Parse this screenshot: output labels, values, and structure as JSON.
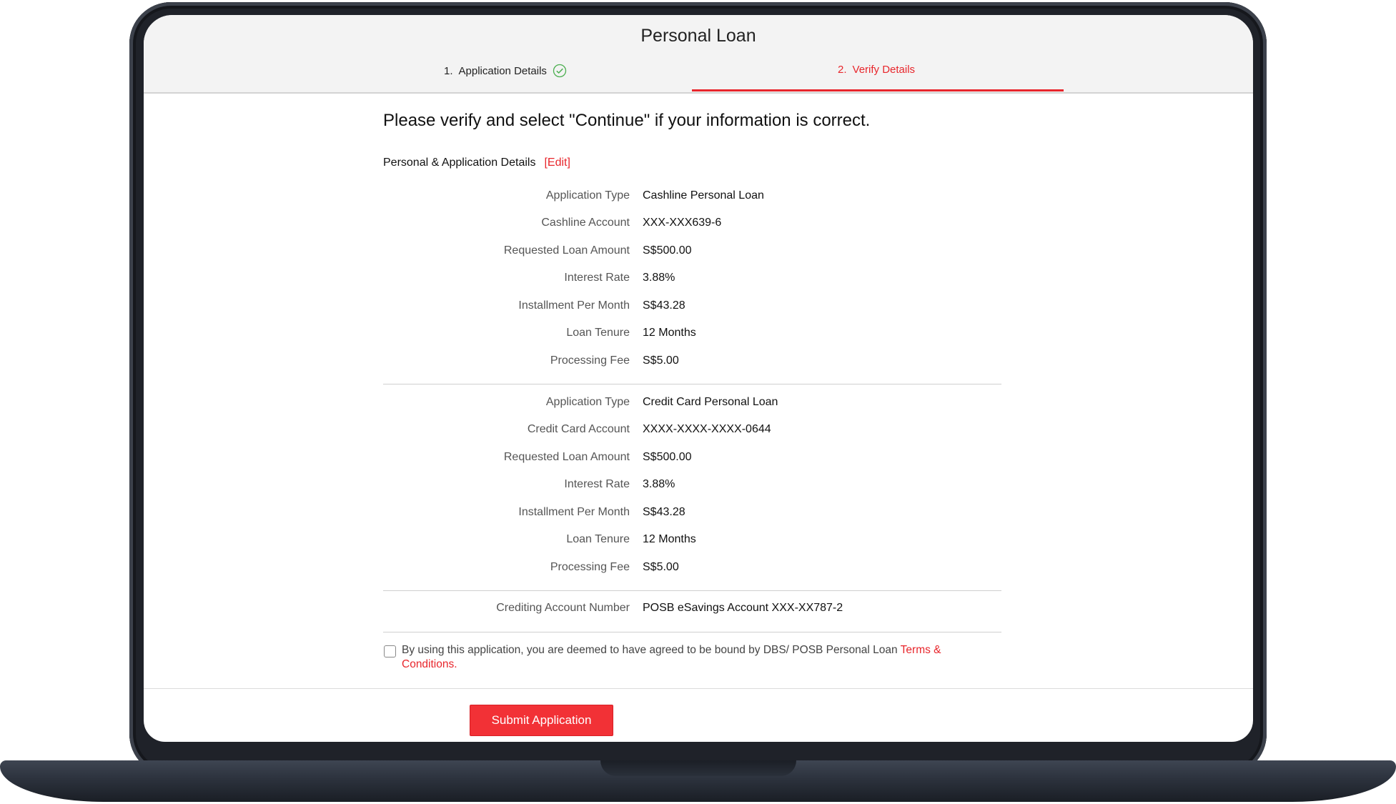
{
  "app": {
    "title": "Personal Loan"
  },
  "steps": [
    {
      "number": "1.",
      "label": "Application Details",
      "status": "completed",
      "icon": "check-circle-icon"
    },
    {
      "number": "2.",
      "label": "Verify Details",
      "status": "active"
    }
  ],
  "verify": {
    "heading": "Please verify and select \"Continue\" if your information is correct.",
    "section_title": "Personal & Application Details",
    "edit_label": "[Edit]"
  },
  "cashline_loan": [
    {
      "label": "Application Type",
      "value": "Cashline Personal Loan"
    },
    {
      "label": "Cashline Account",
      "value": "XXX-XXX639-6"
    },
    {
      "label": "Requested Loan Amount",
      "value": "S$500.00"
    },
    {
      "label": "Interest Rate",
      "value": "3.88%"
    },
    {
      "label": "Installment Per Month",
      "value": "S$43.28"
    },
    {
      "label": "Loan Tenure",
      "value": "12 Months"
    },
    {
      "label": "Processing Fee",
      "value": "S$5.00"
    }
  ],
  "credit_card_loan": [
    {
      "label": "Application Type",
      "value": "Credit Card Personal Loan"
    },
    {
      "label": "Credit Card Account",
      "value": "XXXX-XXXX-XXXX-0644"
    },
    {
      "label": "Requested Loan Amount",
      "value": "S$500.00"
    },
    {
      "label": "Interest Rate",
      "value": "3.88%"
    },
    {
      "label": "Installment Per Month",
      "value": "S$43.28"
    },
    {
      "label": "Loan Tenure",
      "value": "12 Months"
    },
    {
      "label": "Processing Fee",
      "value": "S$5.00"
    }
  ],
  "crediting": {
    "label": "Crediting Account Number",
    "value": "POSB eSavings Account XXX-XX787-2"
  },
  "terms": {
    "text": "By using this application, you are deemed to have agreed to be bound by DBS/ POSB Personal Loan ",
    "link": "Terms & Conditions",
    "suffix": ".",
    "checked": false
  },
  "actions": {
    "submit_label": "Submit Application"
  },
  "colors": {
    "accent": "#e8262c",
    "button": "#f23136",
    "header_bg": "#f3f3f3",
    "success": "#4caf50"
  }
}
